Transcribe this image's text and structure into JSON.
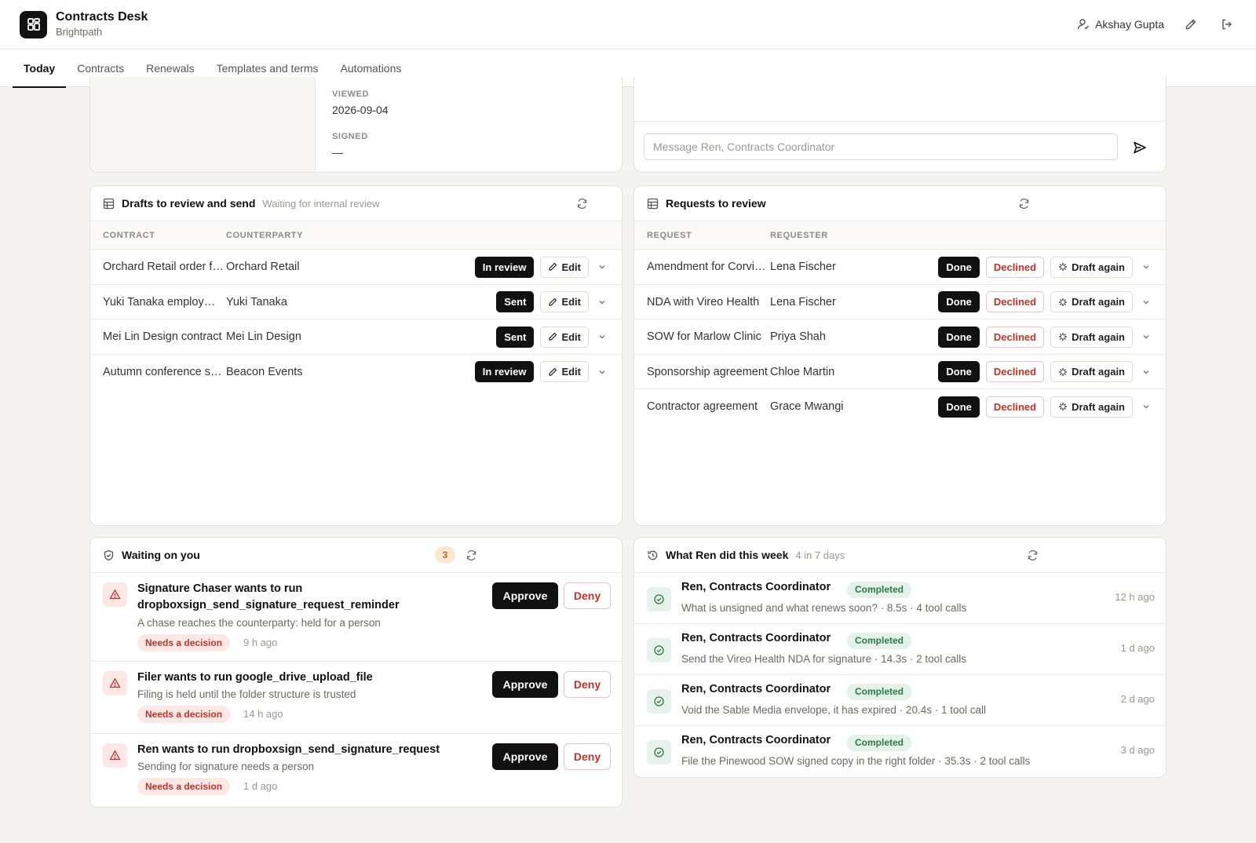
{
  "app": {
    "title": "Contracts Desk",
    "subtitle": "Brightpath",
    "user": "Akshay Gupta"
  },
  "tabs": [
    "Today",
    "Contracts",
    "Renewals",
    "Templates and terms",
    "Automations"
  ],
  "envelope": {
    "viewed_label": "VIEWED",
    "viewed_value": "2026-09-04",
    "signed_label": "SIGNED",
    "signed_value": "—"
  },
  "chat": {
    "placeholder": "Message Ren, Contracts Coordinator"
  },
  "drafts": {
    "title": "Drafts to review and send",
    "subtitle": "Waiting for internal review",
    "columns": [
      "CONTRACT",
      "COUNTERPARTY"
    ],
    "edit_label": "Edit",
    "rows": [
      {
        "contract": "Orchard Retail order form",
        "counterparty": "Orchard Retail",
        "status": "In review"
      },
      {
        "contract": "Yuki Tanaka employment offer",
        "counterparty": "Yuki Tanaka",
        "status": "Sent"
      },
      {
        "contract": "Mei Lin Design contract",
        "counterparty": "Mei Lin Design",
        "status": "Sent"
      },
      {
        "contract": "Autumn conference sponsorship",
        "counterparty": "Beacon Events",
        "status": "In review"
      }
    ]
  },
  "requests": {
    "title": "Requests to review",
    "columns": [
      "REQUEST",
      "REQUESTER"
    ],
    "done_label": "Done",
    "declined_label": "Declined",
    "draft_again_label": "Draft again",
    "rows": [
      {
        "request": "Amendment for Corvid Labs",
        "requester": "Lena Fischer"
      },
      {
        "request": "NDA with Vireo Health",
        "requester": "Lena Fischer"
      },
      {
        "request": "SOW for Marlow Clinic",
        "requester": "Priya Shah"
      },
      {
        "request": "Sponsorship agreement",
        "requester": "Chloe Martin"
      },
      {
        "request": "Contractor agreement",
        "requester": "Grace Mwangi"
      }
    ]
  },
  "waiting": {
    "title": "Waiting on you",
    "count": "3",
    "approve_label": "Approve",
    "deny_label": "Deny",
    "items": [
      {
        "title": "Signature Chaser wants to run dropboxsign_send_signature_request_reminder",
        "description": "A chase reaches the counterparty: held for a person",
        "status": "Needs a decision",
        "time": "9 h ago"
      },
      {
        "title": "Filer wants to run google_drive_upload_file",
        "description": "Filing is held until the folder structure is trusted",
        "status": "Needs a decision",
        "time": "14 h ago"
      },
      {
        "title": "Ren wants to run dropboxsign_send_signature_request",
        "description": "Sending for signature needs a person",
        "status": "Needs a decision",
        "time": "1 d ago"
      }
    ]
  },
  "activity": {
    "title": "What Ren did this week",
    "subtitle": "4 in 7 days",
    "items": [
      {
        "agent": "Ren, Contracts Coordinator",
        "status": "Completed",
        "description": "What is unsigned and what renews soon? · 8.5s · 4 tool calls",
        "time": "12 h ago"
      },
      {
        "agent": "Ren, Contracts Coordinator",
        "status": "Completed",
        "description": "Send the Vireo Health NDA for signature · 14.3s · 2 tool calls",
        "time": "1 d ago"
      },
      {
        "agent": "Ren, Contracts Coordinator",
        "status": "Completed",
        "description": "Void the Sable Media envelope, it has expired · 20.4s · 1 tool call",
        "time": "2 d ago"
      },
      {
        "agent": "Ren, Contracts Coordinator",
        "status": "Completed",
        "description": "File the Pinewood SOW signed copy in the right folder · 35.3s · 2 tool calls",
        "time": "3 d ago"
      }
    ]
  }
}
